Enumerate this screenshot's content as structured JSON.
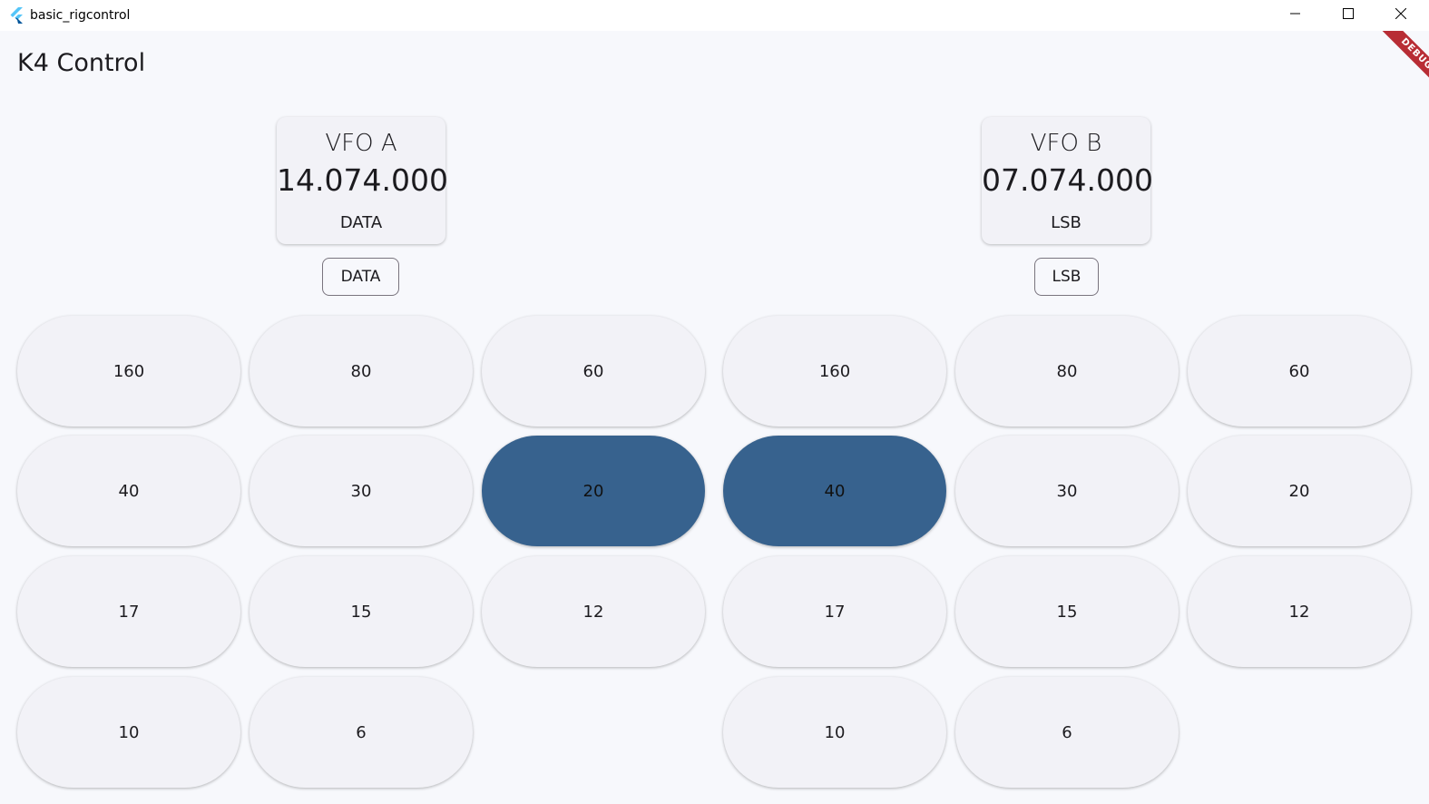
{
  "window": {
    "title": "basic_rigcontrol",
    "app_icon": "flutter-logo-icon",
    "controls": [
      "minimize-icon",
      "maximize-icon",
      "close-icon"
    ]
  },
  "app": {
    "title": "K4 Control",
    "debug_banner": "DEBUG"
  },
  "vfo_a": {
    "label": "VFO A",
    "frequency": "14.074.000",
    "mode": "DATA",
    "mode_button": "DATA",
    "bands": [
      {
        "label": "160",
        "selected": false
      },
      {
        "label": "80",
        "selected": false
      },
      {
        "label": "60",
        "selected": false
      },
      {
        "label": "40",
        "selected": false
      },
      {
        "label": "30",
        "selected": false
      },
      {
        "label": "20",
        "selected": true
      },
      {
        "label": "17",
        "selected": false
      },
      {
        "label": "15",
        "selected": false
      },
      {
        "label": "12",
        "selected": false
      },
      {
        "label": "10",
        "selected": false
      },
      {
        "label": "6",
        "selected": false
      }
    ]
  },
  "vfo_b": {
    "label": "VFO B",
    "frequency": "07.074.000",
    "mode": "LSB",
    "mode_button": "LSB",
    "bands": [
      {
        "label": "160",
        "selected": false
      },
      {
        "label": "80",
        "selected": false
      },
      {
        "label": "60",
        "selected": false
      },
      {
        "label": "40",
        "selected": true
      },
      {
        "label": "30",
        "selected": false
      },
      {
        "label": "20",
        "selected": false
      },
      {
        "label": "17",
        "selected": false
      },
      {
        "label": "15",
        "selected": false
      },
      {
        "label": "12",
        "selected": false
      },
      {
        "label": "10",
        "selected": false
      },
      {
        "label": "6",
        "selected": false
      }
    ]
  },
  "colors": {
    "selected_band": "#37628e",
    "button_bg": "#f2f2f7",
    "page_bg": "#f7f8fc",
    "debug_ribbon": "#b82d35"
  }
}
